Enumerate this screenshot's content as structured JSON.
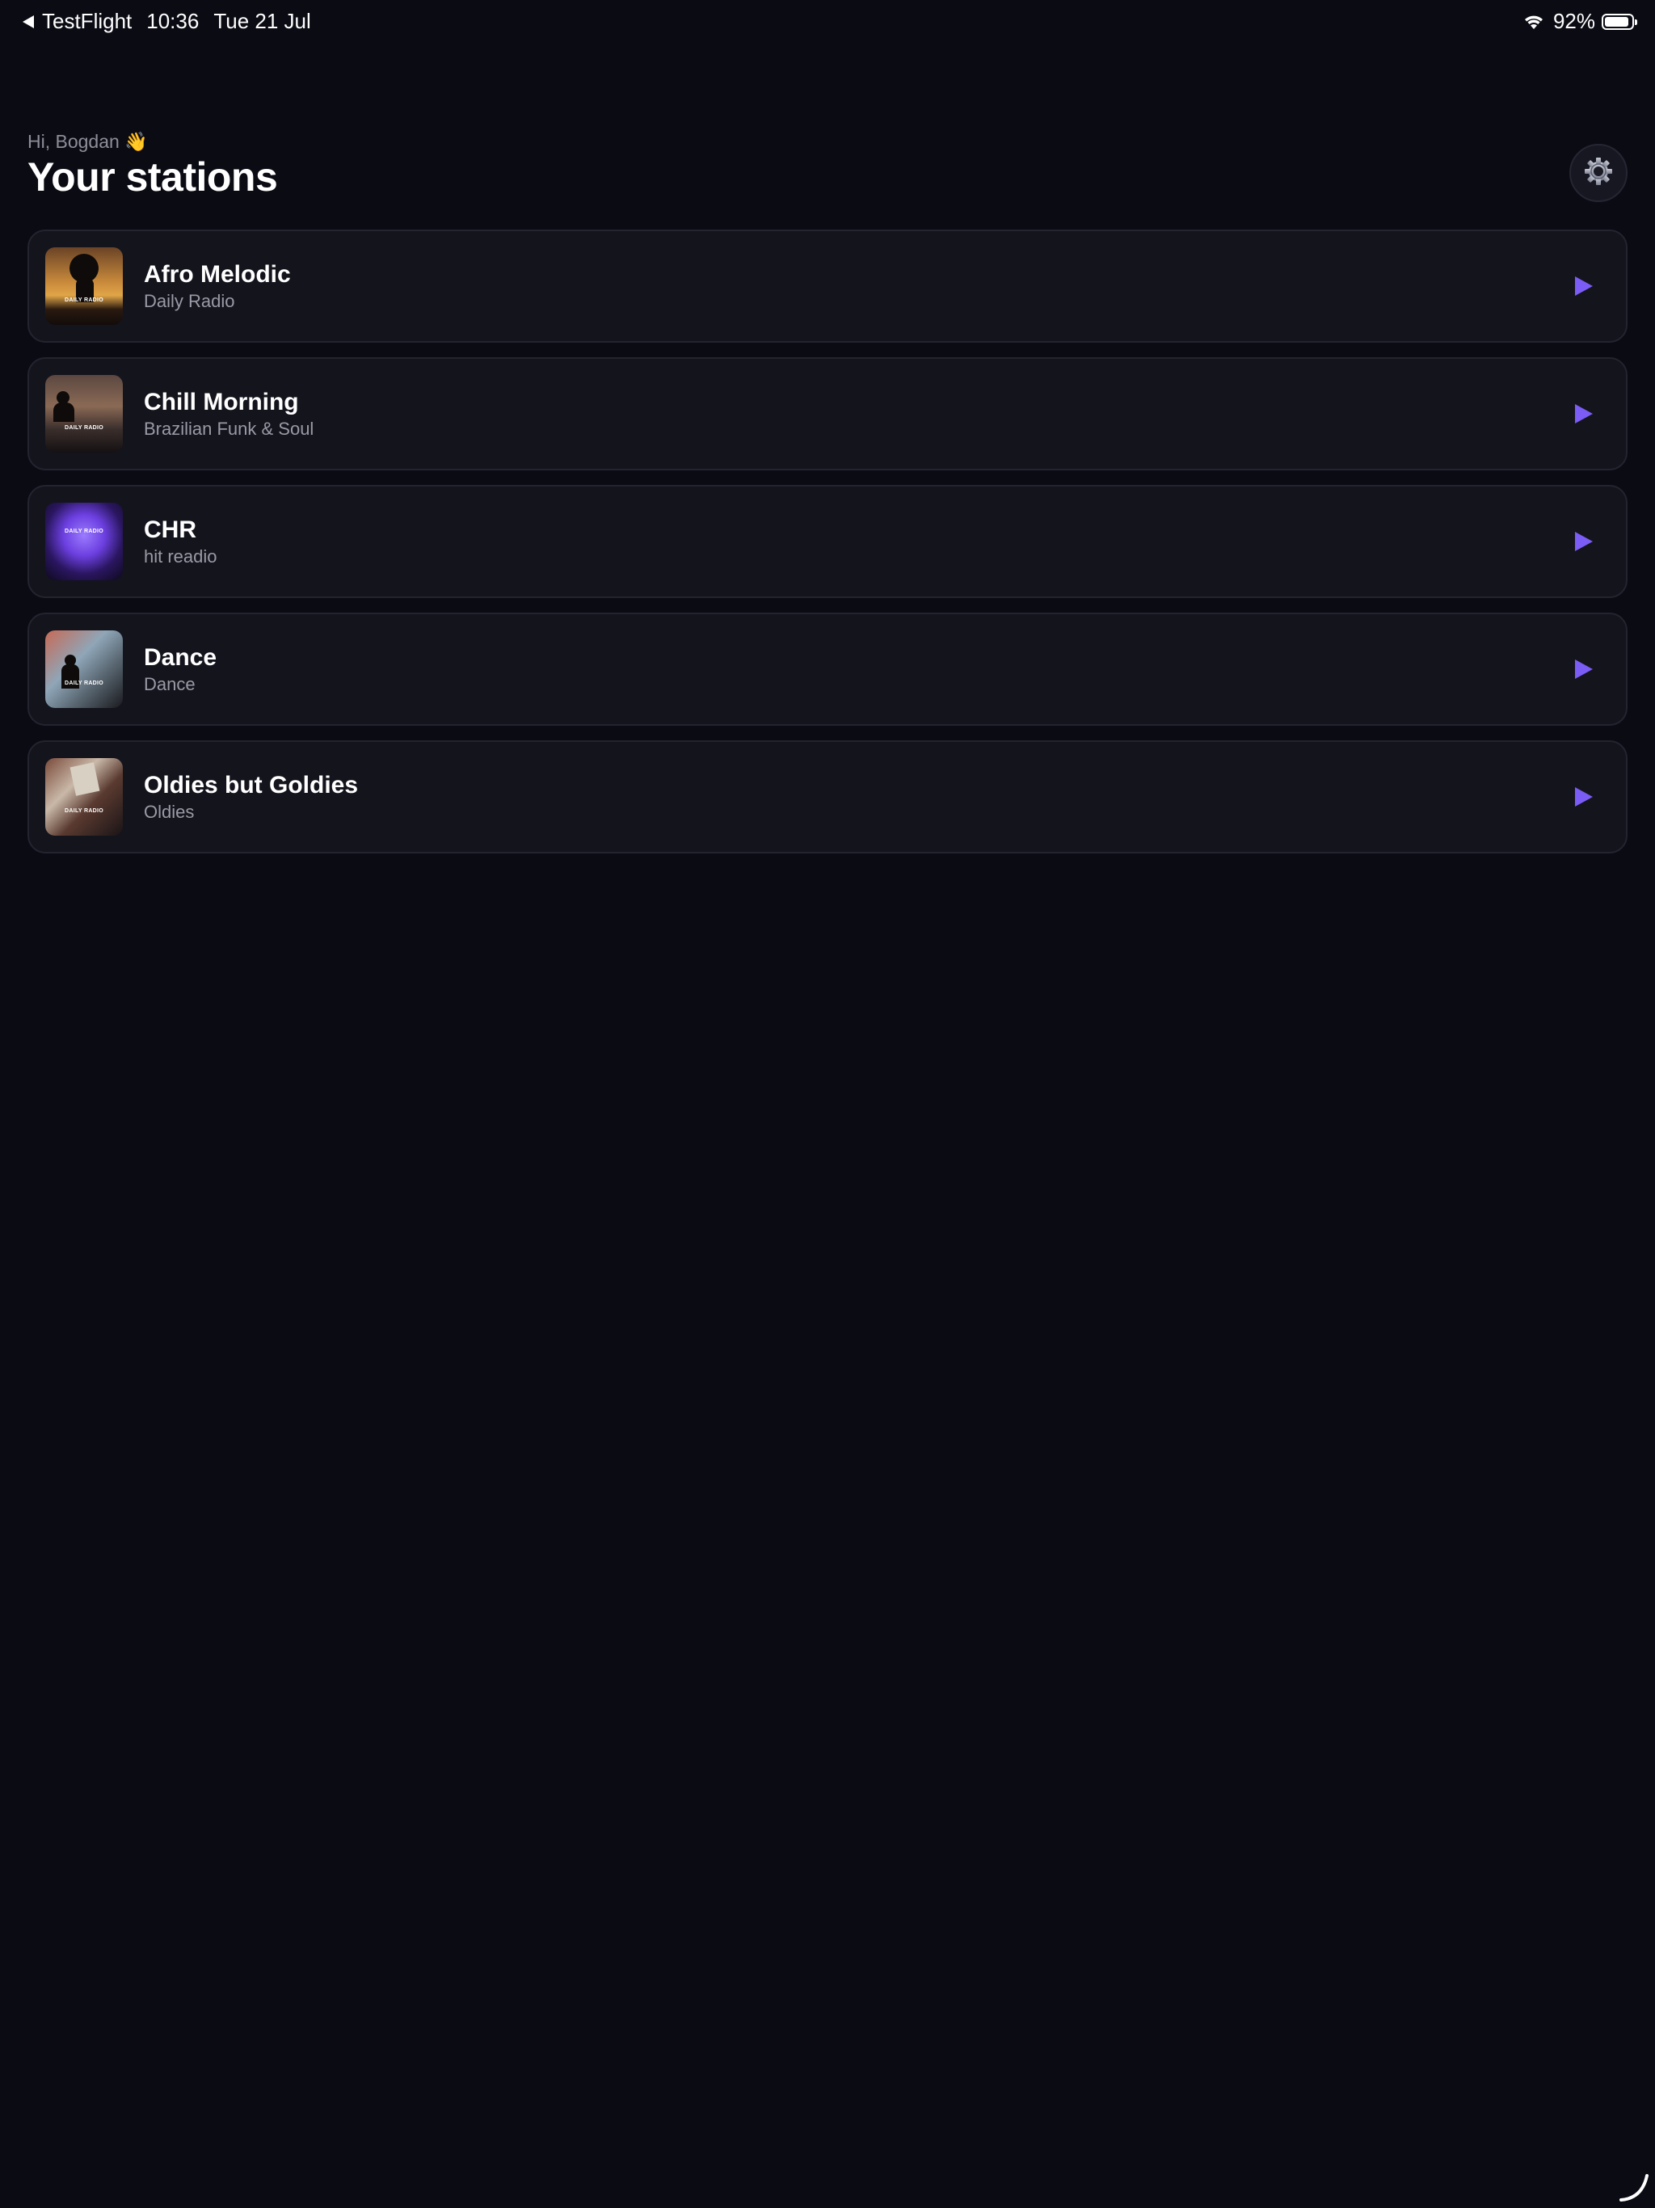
{
  "status_bar": {
    "back_app": "TestFlight",
    "time": "10:36",
    "date": "Tue 21 Jul",
    "battery_percent": "92%",
    "battery_level": 0.92
  },
  "header": {
    "greeting": "Hi, Bogdan 👋",
    "title": "Your stations",
    "settings_icon": "gear-icon"
  },
  "stations": [
    {
      "name": "Afro Melodic",
      "subtitle": "Daily Radio",
      "cover_brand": "DAILY RADIO"
    },
    {
      "name": "Chill Morning",
      "subtitle": "Brazilian Funk & Soul",
      "cover_brand": "DAILY RADIO"
    },
    {
      "name": "CHR",
      "subtitle": "hit readio",
      "cover_brand": "DAILY RADIO"
    },
    {
      "name": "Dance",
      "subtitle": "Dance",
      "cover_brand": "DAILY RADIO"
    },
    {
      "name": "Oldies but Goldies",
      "subtitle": "Oldies",
      "cover_brand": "DAILY RADIO"
    }
  ],
  "colors": {
    "background": "#0b0b14",
    "card": "#14141d",
    "accent": "#7b5cf5",
    "subtitle": "#9a9aa6"
  }
}
